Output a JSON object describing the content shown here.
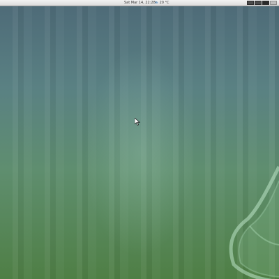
{
  "top_panel": {
    "clock": "Sat Mar 14, 22:28",
    "weather": {
      "icon": "weather-cloud-icon",
      "temperature": "20 °C"
    },
    "workspace_switcher": {
      "count": 4,
      "active_index": 2
    }
  },
  "desktop": {
    "wallpaper": "green-striped-leaf",
    "colors": {
      "top": "#4e6b78",
      "bottom": "#4f7f45"
    }
  }
}
